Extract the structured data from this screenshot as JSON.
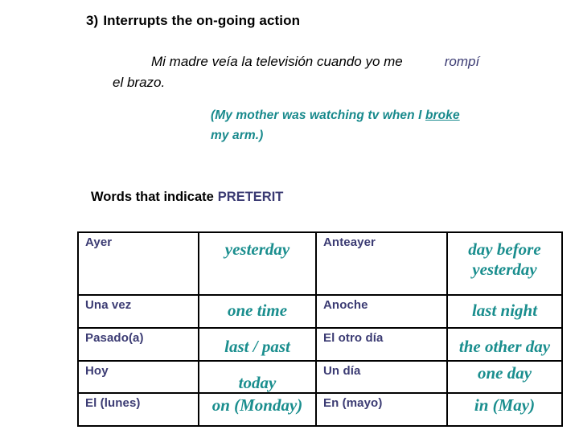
{
  "heading": {
    "number": "3)",
    "text": "Interrupts the on-going action"
  },
  "example": {
    "spanish_part1": "Mi madre veía la televisión cuando yo me",
    "spanish_verb": "rompí",
    "spanish_part2": "el brazo.",
    "english_line1_pre": "(My mother was watching tv when I ",
    "english_underlined": "broke",
    "english_line2": "my arm.)"
  },
  "section": {
    "label": "Words that indicate",
    "emphasis": "PRETERIT"
  },
  "table": {
    "rows": [
      {
        "sp1": "Ayer",
        "en1": "yesterday",
        "sp2": "Anteayer",
        "en2_line1": "day before",
        "en2_line2": "yesterday"
      },
      {
        "sp1": "Una vez",
        "en1": "one time",
        "sp2": "Anoche",
        "en2": "last night"
      },
      {
        "sp1": "Pasado(a)",
        "en1": "last / past",
        "sp2": "El otro día",
        "en2": "the other day"
      },
      {
        "sp1": "Hoy",
        "en1": "today",
        "sp2": "Un día",
        "en2": "one day"
      },
      {
        "sp1": "El (lunes)",
        "en1": "on (Monday)",
        "sp2": "En (mayo)",
        "en2": "in (May)"
      }
    ]
  },
  "colors": {
    "navy": "#3b3b73",
    "teal": "#1a8e8e",
    "english_teal": "#17898c",
    "black": "#000000",
    "border": "#000000"
  }
}
